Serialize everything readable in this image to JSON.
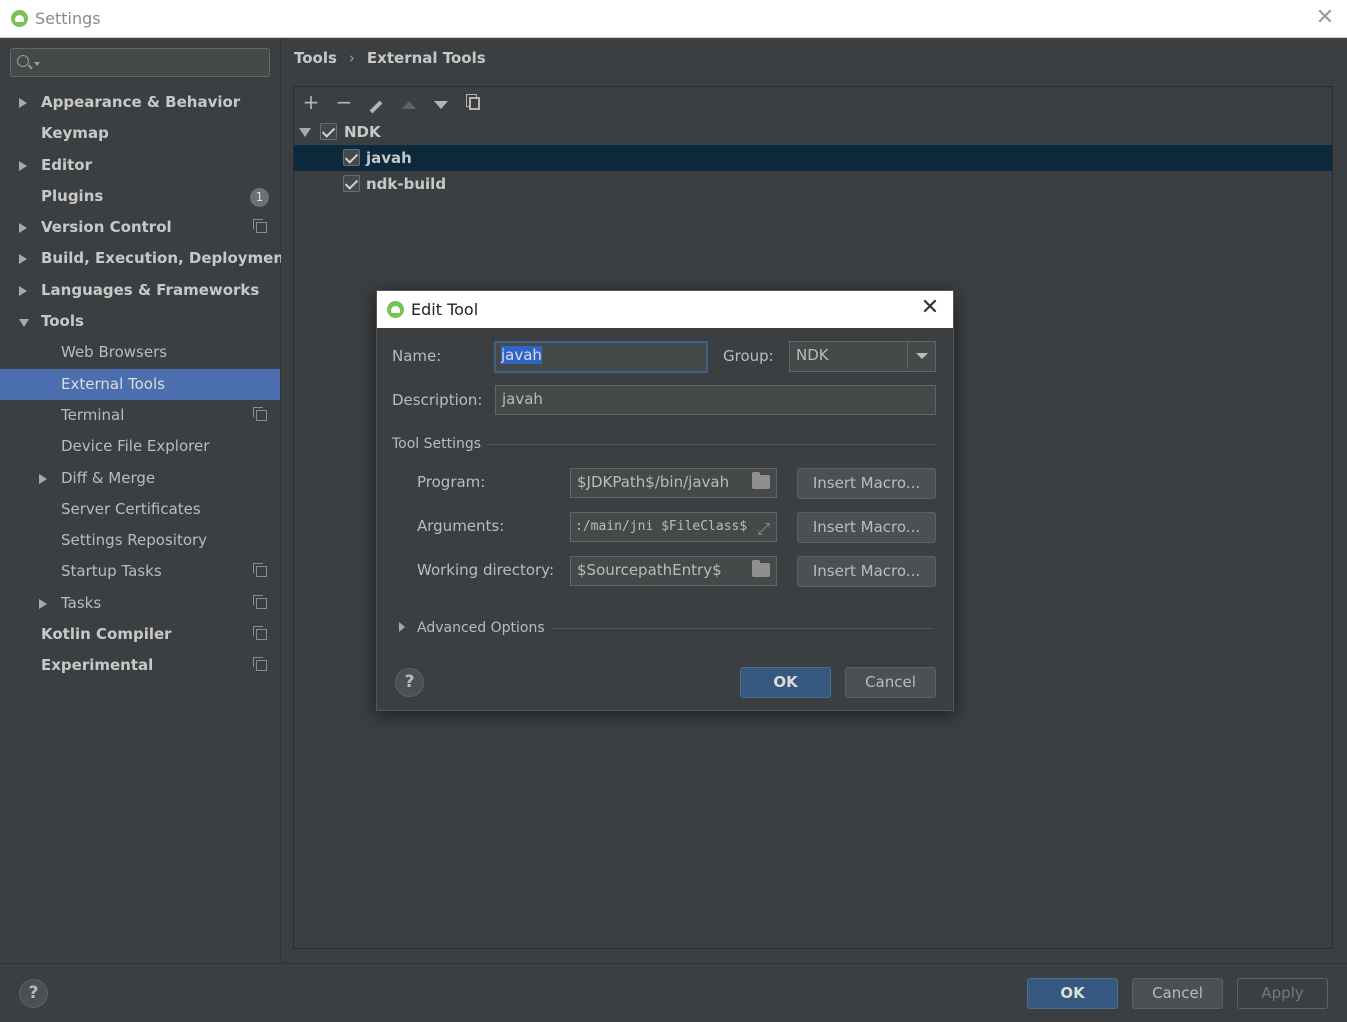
{
  "window": {
    "title": "Settings"
  },
  "sidebar": {
    "search": {
      "value": "",
      "placeholder": ""
    },
    "items": [
      {
        "label": "Appearance & Behavior",
        "bold": true,
        "expander": "collapsed"
      },
      {
        "label": "Keymap",
        "bold": true
      },
      {
        "label": "Editor",
        "bold": true,
        "expander": "collapsed"
      },
      {
        "label": "Plugins",
        "bold": true,
        "badge": "1"
      },
      {
        "label": "Version Control",
        "bold": true,
        "expander": "collapsed",
        "project_icon": true
      },
      {
        "label": "Build, Execution, Deployment",
        "bold": true,
        "expander": "collapsed"
      },
      {
        "label": "Languages & Frameworks",
        "bold": true,
        "expander": "collapsed"
      },
      {
        "label": "Tools",
        "bold": true,
        "expander": "expanded"
      },
      {
        "label": "Web Browsers"
      },
      {
        "label": "External Tools",
        "selected": true
      },
      {
        "label": "Terminal",
        "project_icon": true
      },
      {
        "label": "Device File Explorer"
      },
      {
        "label": "Diff & Merge",
        "expander": "collapsed"
      },
      {
        "label": "Server Certificates"
      },
      {
        "label": "Settings Repository"
      },
      {
        "label": "Startup Tasks",
        "project_icon": true
      },
      {
        "label": "Tasks",
        "expander": "collapsed",
        "project_icon": true
      },
      {
        "label": "Kotlin Compiler",
        "bold": true,
        "project_icon": true
      },
      {
        "label": "Experimental",
        "bold": true,
        "project_icon": true
      }
    ]
  },
  "breadcrumb": {
    "parent": "Tools",
    "separator": "›",
    "current": "External Tools"
  },
  "toolbar": {
    "add": "+",
    "remove": "−",
    "edit_icon": "pencil-icon",
    "move_up_icon": "arrow-up-icon",
    "move_down_icon": "arrow-down-icon",
    "copy_icon": "copy-icon"
  },
  "tools_tree": {
    "group": {
      "label": "NDK",
      "checked": true
    },
    "items": [
      {
        "label": "javah",
        "checked": true,
        "selected": true
      },
      {
        "label": "ndk-build",
        "checked": true
      }
    ]
  },
  "dialog": {
    "title": "Edit Tool",
    "name_label": "Name:",
    "name_value": "javah",
    "group_label": "Group:",
    "group_value": "NDK",
    "description_label": "Description:",
    "description_value": "javah",
    "tool_settings_label": "Tool Settings",
    "program_label": "Program:",
    "program_value": "$JDKPath$/bin/javah",
    "arguments_label": "Arguments:",
    "arguments_value": ":/main/jni $FileClass$",
    "workdir_label": "Working directory:",
    "workdir_value": "$SourcepathEntry$",
    "insert_macro": "Insert Macro...",
    "advanced_label": "Advanced Options",
    "help": "?",
    "ok": "OK",
    "cancel": "Cancel"
  },
  "footer": {
    "help": "?",
    "ok": "OK",
    "cancel": "Cancel",
    "apply": "Apply"
  },
  "colors": {
    "background": "#3c3f41",
    "selection": "#4b6eaf",
    "tree_selection": "#0d293e",
    "primary_button": "#365880",
    "text_selection": "#2f65ca"
  }
}
